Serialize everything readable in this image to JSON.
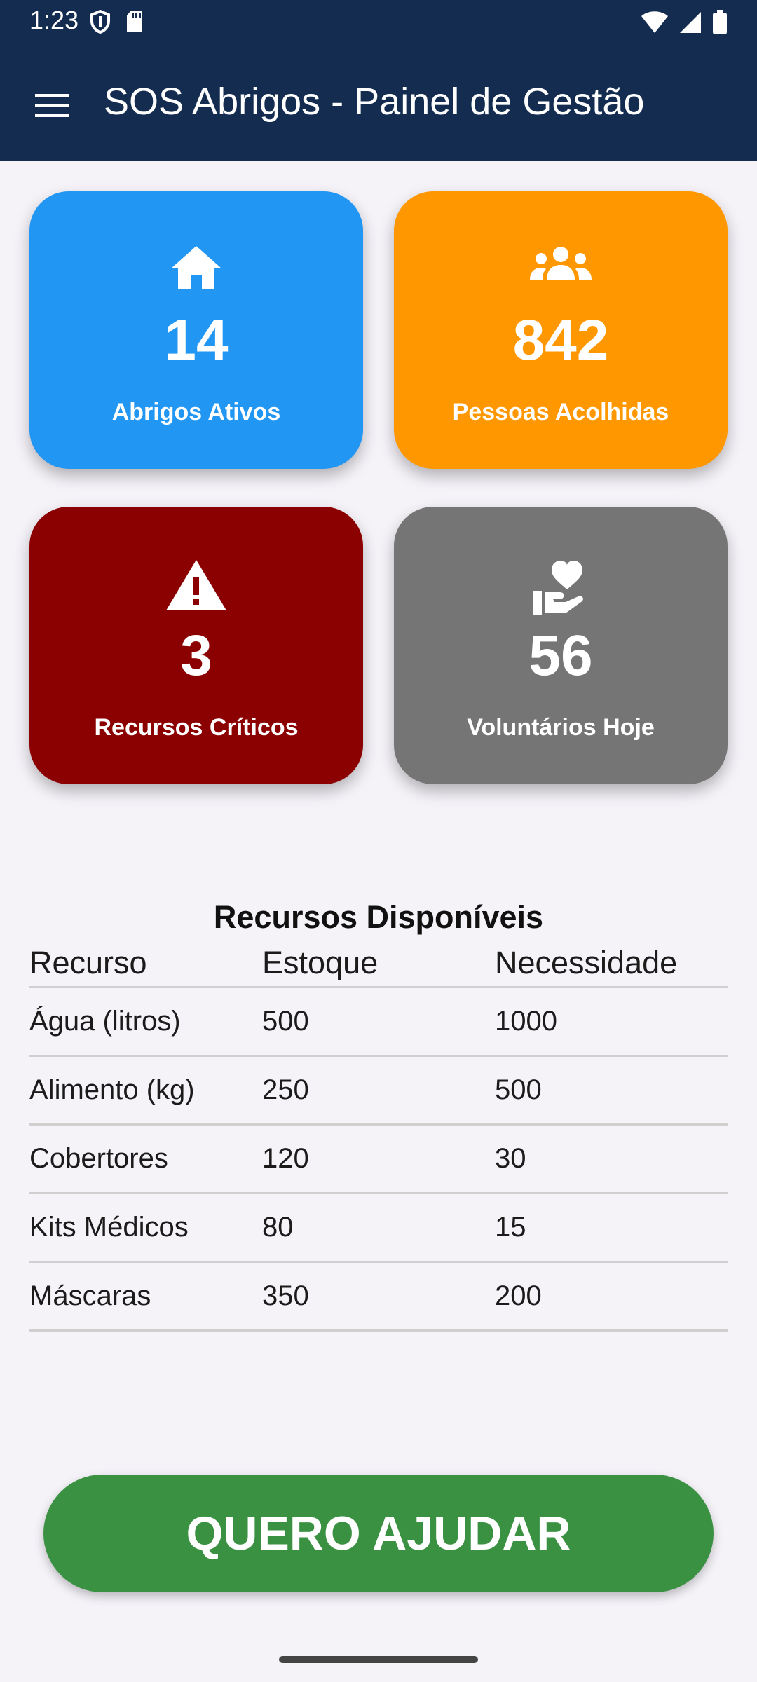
{
  "status_bar": {
    "time": "1:23",
    "left_icons": [
      "shield-icon",
      "sd-card-icon"
    ],
    "right_icons": [
      "wifi-icon",
      "signal-icon",
      "battery-icon"
    ]
  },
  "app_bar": {
    "title": "SOS Abrigos - Painel de Gestão",
    "menu_icon": "menu-icon"
  },
  "cards": [
    {
      "value": "14",
      "label": "Abrigos Ativos",
      "icon": "home-icon",
      "color": "#2196f3"
    },
    {
      "value": "842",
      "label": "Pessoas Acolhidas",
      "icon": "people-icon",
      "color": "#ff9800"
    },
    {
      "value": "3",
      "label": "Recursos Críticos",
      "icon": "warning-icon",
      "color": "#8b0000"
    },
    {
      "value": "56",
      "label": "Voluntários Hoje",
      "icon": "volunteer-heart-icon",
      "color": "#757575"
    }
  ],
  "resources_table": {
    "title": "Recursos Disponíveis",
    "columns": [
      "Recurso",
      "Estoque",
      "Necessidade"
    ],
    "rows": [
      [
        "Água (litros)",
        "500",
        "1000"
      ],
      [
        "Alimento (kg)",
        "250",
        "500"
      ],
      [
        "Cobertores",
        "120",
        "30"
      ],
      [
        "Kits Médicos",
        "80",
        "15"
      ],
      [
        "Máscaras",
        "350",
        "200"
      ]
    ]
  },
  "help_button": {
    "label": "QUERO AJUDAR",
    "color": "#3a9141"
  },
  "colors": {
    "app_bar": "#132c4f",
    "background": "#f5f3f8"
  }
}
